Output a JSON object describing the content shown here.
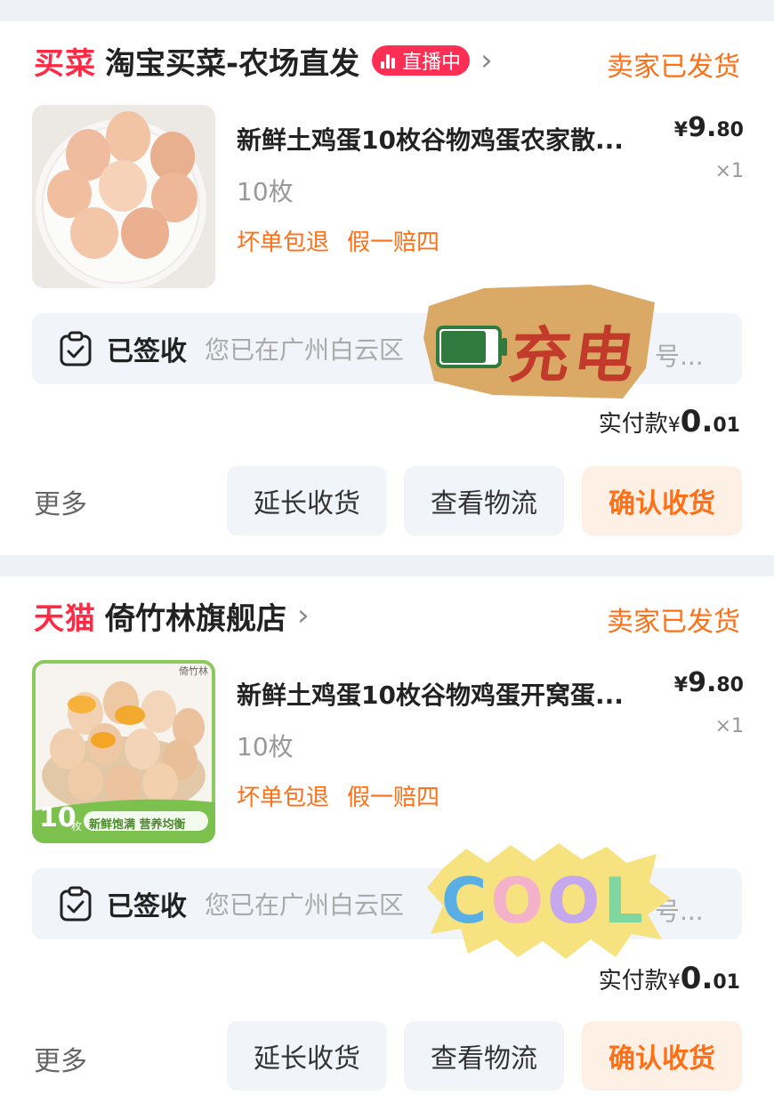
{
  "orders": [
    {
      "brand_tag": "买菜",
      "store_name": "淘宝买菜-农场直发",
      "live_badge": "直播中",
      "status": "卖家已发货",
      "product": {
        "title": "新鲜土鸡蛋10枚谷物鸡蛋农家散...",
        "price_symbol": "¥",
        "price_int": "9.",
        "price_dec": "80",
        "quantity": "×1",
        "spec": "10枚",
        "guarantees": [
          "坏单包退",
          "假一赔四"
        ]
      },
      "tracking": {
        "state": "已签收",
        "detail": "您已在广州白云区",
        "detail_tail": "号..."
      },
      "paid": {
        "label": "实付款",
        "symbol": "¥",
        "int": "0.",
        "dec": "01"
      },
      "actions": {
        "more": "更多",
        "extend": "延长收货",
        "logistics": "查看物流",
        "confirm": "确认收货"
      }
    },
    {
      "brand_tag": "天猫",
      "store_name": "倚竹林旗舰店",
      "status": "卖家已发货",
      "product": {
        "title": "新鲜土鸡蛋10枚谷物鸡蛋开窝蛋...",
        "price_symbol": "¥",
        "price_int": "9.",
        "price_dec": "80",
        "quantity": "×1",
        "spec": "10枚",
        "guarantees": [
          "坏单包退",
          "假一赔四"
        ],
        "image_text": {
          "brand": "倚竹林",
          "count": "10",
          "unit": "枚",
          "slogan": "新鲜饱满 营养均衡"
        }
      },
      "tracking": {
        "state": "已签收",
        "detail": "您已在广州白云区",
        "detail_tail": "号..."
      },
      "paid": {
        "label": "实付款",
        "symbol": "¥",
        "int": "0.",
        "dec": "01"
      },
      "actions": {
        "more": "更多",
        "extend": "延长收货",
        "logistics": "查看物流",
        "confirm": "确认收货"
      }
    }
  ],
  "stickers": {
    "charge": "充电",
    "cool": "COOL"
  },
  "colors": {
    "accent": "#ff6f16",
    "brand_red": "#ff2b45",
    "live": "#ff2e55",
    "confirm_bg": "#fff0e6"
  },
  "icons": [
    "chevron-right-icon",
    "clipboard-check-icon",
    "live-bars-icon"
  ]
}
